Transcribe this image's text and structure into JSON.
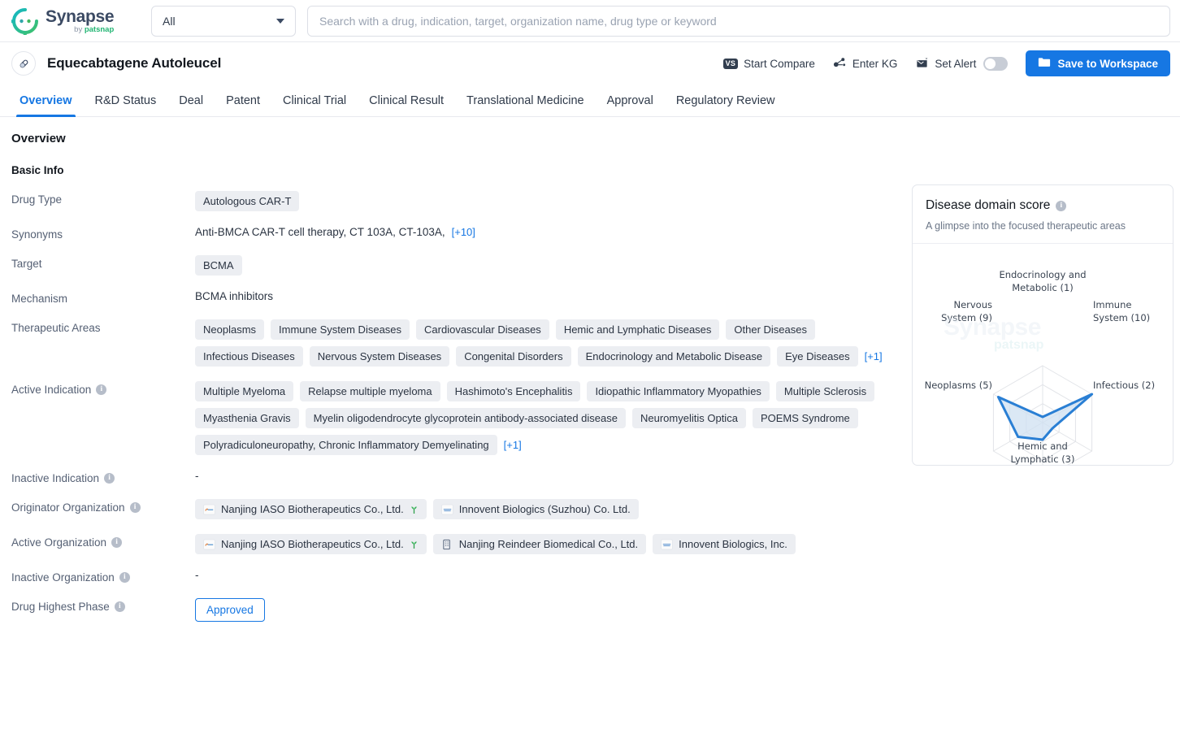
{
  "brand": {
    "name": "Synapse",
    "by": "by ",
    "sub": "patsnap",
    "logo_icon": "synapse-logo-icon"
  },
  "search": {
    "scope_value": "All",
    "placeholder": "Search with a drug, indication, target, organization name, drug type or keyword"
  },
  "drug_header": {
    "title": "Equecabtagene Autoleucel",
    "icon": "capsule-icon",
    "actions": [
      {
        "label": "Start Compare",
        "icon": "vs-icon"
      },
      {
        "label": "Enter KG",
        "icon": "knowledge-graph-icon"
      },
      {
        "label": "Set Alert",
        "icon": "alert-bell-icon"
      }
    ],
    "save_label": "Save to Workspace",
    "save_icon": "folder-icon",
    "accent_color": "#1677e3"
  },
  "tabs": [
    {
      "label": "Overview",
      "active": true
    },
    {
      "label": "R&D Status",
      "active": false
    },
    {
      "label": "Deal",
      "active": false
    },
    {
      "label": "Patent",
      "active": false
    },
    {
      "label": "Clinical Trial",
      "active": false
    },
    {
      "label": "Clinical Result",
      "active": false
    },
    {
      "label": "Translational Medicine",
      "active": false
    },
    {
      "label": "Approval",
      "active": false
    },
    {
      "label": "Regulatory Review",
      "active": false
    }
  ],
  "overview": {
    "section_title": "Overview",
    "basic_info_title": "Basic Info",
    "drug_type": {
      "label": "Drug Type",
      "tags": [
        "Autologous CAR-T"
      ]
    },
    "synonyms": {
      "label": "Synonyms",
      "text": "Anti-BMCA CAR-T cell therapy,  CT 103A,  CT-103A,",
      "more": "[+10]"
    },
    "target": {
      "label": "Target",
      "tags": [
        "BCMA"
      ]
    },
    "mechanism": {
      "label": "Mechanism",
      "text": "BCMA inhibitors"
    },
    "therapeutic_areas": {
      "label": "Therapeutic Areas",
      "tags": [
        "Neoplasms",
        "Immune System Diseases",
        "Cardiovascular Diseases",
        "Hemic and Lymphatic Diseases",
        "Other Diseases",
        "Infectious Diseases",
        "Nervous System Diseases",
        "Congenital Disorders",
        "Endocrinology and Metabolic Disease",
        "Eye Diseases"
      ],
      "more": "[+1]"
    },
    "active_indication": {
      "label": "Active Indication",
      "tags": [
        "Multiple Myeloma",
        "Relapse multiple myeloma",
        "Hashimoto's Encephalitis",
        "Idiopathic Inflammatory Myopathies",
        "Multiple Sclerosis",
        "Myasthenia Gravis",
        "Myelin oligodendrocyte glycoprotein antibody-associated disease",
        "Neuromyelitis Optica",
        "POEMS Syndrome",
        "Polyradiculoneuropathy, Chronic Inflammatory Demyelinating"
      ],
      "more": "[+1]"
    },
    "inactive_indication": {
      "label": "Inactive Indication",
      "value": "-"
    },
    "originator_organization": {
      "label": "Originator Organization",
      "orgs": [
        {
          "name": "Nanjing IASO Biotherapeutics Co., Ltd.",
          "icon": "company-logo-icon",
          "green": true,
          "sprout": true
        },
        {
          "name": "Innovent Biologics (Suzhou) Co. Ltd.",
          "icon": "company-logo-icon",
          "green": false,
          "sprout": false
        }
      ]
    },
    "active_organization": {
      "label": "Active Organization",
      "orgs": [
        {
          "name": "Nanjing IASO Biotherapeutics Co., Ltd.",
          "icon": "company-logo-icon",
          "green": true,
          "sprout": true
        },
        {
          "name": "Nanjing Reindeer Biomedical Co., Ltd.",
          "icon": "building-icon",
          "green": false,
          "sprout": false
        },
        {
          "name": "Innovent Biologics, Inc.",
          "icon": "company-logo-icon",
          "green": false,
          "sprout": false
        }
      ]
    },
    "inactive_organization": {
      "label": "Inactive Organization",
      "value": "-"
    },
    "drug_highest_phase": {
      "label": "Drug Highest Phase",
      "value": "Approved"
    }
  },
  "disease_card": {
    "title": "Disease domain score",
    "subtitle": "A glimpse into the focused therapeutic areas",
    "info_icon": "info-icon",
    "watermark_name": "Synapse",
    "watermark_sub": "patsnap"
  },
  "chart_data": {
    "type": "radar",
    "title": "Disease domain score",
    "subtitle": "A glimpse into the focused therapeutic areas",
    "categories": [
      "Endocrinology and Metabolic",
      "Immune System",
      "Infectious",
      "Hemic and Lymphatic",
      "Neoplasms",
      "Nervous System"
    ],
    "tick_labels": [
      "Endocrinology and Metabolic (1)",
      "Immune System (10)",
      "Infectious (2)",
      "Hemic and Lymphatic (3)",
      "Neoplasms (5)",
      "Nervous System (9)"
    ],
    "values": [
      1,
      10,
      2,
      3,
      5,
      9
    ],
    "max": 10,
    "rings": 3,
    "grid": true,
    "legend": "none",
    "line_color": "#2a7fd4",
    "fill_color": "#cfe0f2",
    "grid_color": "#e2e4e8"
  }
}
